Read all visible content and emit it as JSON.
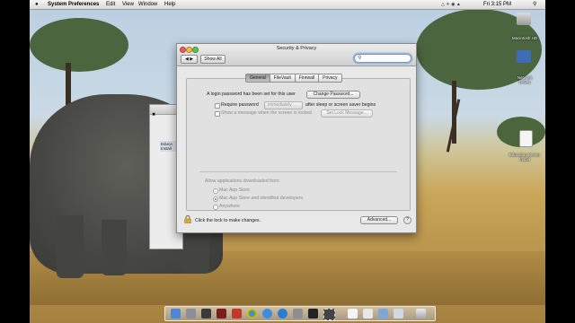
{
  "menubar": {
    "apple": "",
    "app_name": "System Preferences",
    "items": [
      "Edit",
      "View",
      "Window",
      "Help"
    ],
    "clock": "Fri 3:15 PM"
  },
  "background_window": {
    "label": "Educa Install"
  },
  "window": {
    "title": "Security & Privacy",
    "show_all": "Show All",
    "search_placeholder": "",
    "tabs": [
      "General",
      "FileVault",
      "Firewall",
      "Privacy"
    ],
    "selected_tab": "General",
    "general": {
      "login_password_text": "A login password has been set for this user",
      "change_password": "Change Password...",
      "require_password_label": "Require password",
      "require_password_value": "immediately",
      "require_password_suffix": "after sleep or screen saver begins",
      "show_message_label": "Show a message when the screen is locked",
      "set_lock_message": "Set Lock Message...",
      "allow_apps_label": "Allow applications downloaded from:",
      "options": [
        "Mac App Store",
        "Mac App Store and identified developers",
        "Anywhere"
      ],
      "selected_option": "Mac App Store and identified developers"
    },
    "lock_text": "Click the lock to make changes.",
    "advanced": "Advanced...",
    "help": "?"
  },
  "desktop_icons": [
    {
      "label": "Macintosh HD",
      "icon": "hard-drive-icon"
    },
    {
      "label": "Network Drives",
      "icon": "network-icon"
    },
    {
      "label": "Education Server Install",
      "icon": "document-icon"
    }
  ],
  "dock": {
    "icons": [
      "finder-icon",
      "launchpad-icon",
      "mission-control-icon",
      "photo-booth-icon",
      "pdf-icon",
      "chrome-icon",
      "safari-icon",
      "app-store-icon",
      "system-preferences-icon",
      "terminal-icon",
      "film-icon",
      "document-icon",
      "document-icon",
      "folder-icon",
      "preview-icon",
      "trash-icon"
    ]
  },
  "colors": {
    "selected_tab": "#a9a9a9",
    "search_focus": "#9cb9e2"
  }
}
